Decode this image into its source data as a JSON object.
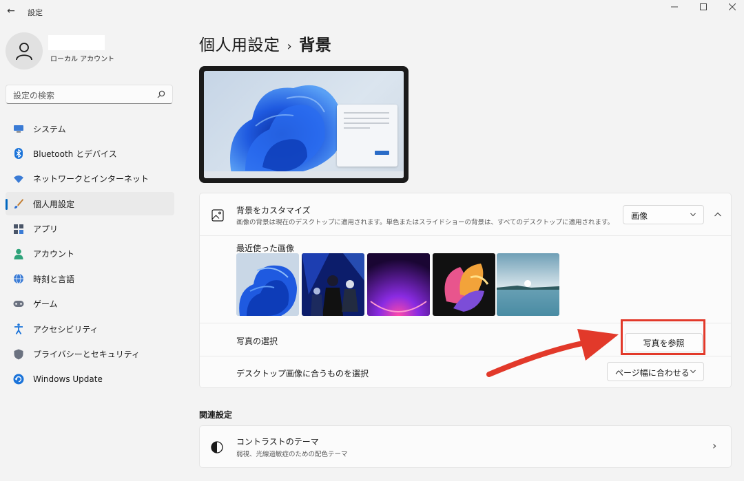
{
  "window": {
    "back_glyph": "←",
    "app_title": "設定",
    "minimize_glyph": "—",
    "maximize_glyph": "☐",
    "close_glyph": "✕"
  },
  "account": {
    "label": "ローカル アカウント"
  },
  "search": {
    "placeholder": "設定の検索"
  },
  "sidebar": {
    "items": [
      {
        "label": "システム",
        "icon": "monitor-icon"
      },
      {
        "label": "Bluetooth とデバイス",
        "icon": "bluetooth-icon"
      },
      {
        "label": "ネットワークとインターネット",
        "icon": "wifi-icon"
      },
      {
        "label": "個人用設定",
        "icon": "brush-icon",
        "active": true
      },
      {
        "label": "アプリ",
        "icon": "apps-icon"
      },
      {
        "label": "アカウント",
        "icon": "person-icon"
      },
      {
        "label": "時刻と言語",
        "icon": "globe-clock-icon"
      },
      {
        "label": "ゲーム",
        "icon": "gamepad-icon"
      },
      {
        "label": "アクセシビリティ",
        "icon": "accessibility-icon"
      },
      {
        "label": "プライバシーとセキュリティ",
        "icon": "shield-icon"
      },
      {
        "label": "Windows Update",
        "icon": "update-icon"
      }
    ]
  },
  "header": {
    "breadcrumb_parent": "個人用設定",
    "breadcrumb_sep": "›",
    "breadcrumb_current": "背景"
  },
  "background_card": {
    "title": "背景をカスタマイズ",
    "description": "画像の背景は現在のデスクトップに適用されます。単色またはスライドショーの背景は、すべてのデスクトップに適用されます。",
    "type_value": "画像",
    "collapse_glyph": "∧",
    "recent_label": "最近使った画像",
    "recent_images": [
      "bloom-blue",
      "anime-characters",
      "purple-glow",
      "abstract-ribbons",
      "lake-sunrise"
    ],
    "choose_photo_label": "写真の選択",
    "browse_label": "写真を参照",
    "fit_label": "デスクトップ画像に合うものを選択",
    "fit_value": "ページ幅に合わせる"
  },
  "related": {
    "section_title": "関連設定",
    "contrast_title": "コントラストのテーマ",
    "contrast_sub": "弱視、光線過敏症のための配色テーマ",
    "chevron_glyph": "›"
  },
  "colors": {
    "accent": "#0067c0",
    "annotation_red": "#e2392a"
  }
}
